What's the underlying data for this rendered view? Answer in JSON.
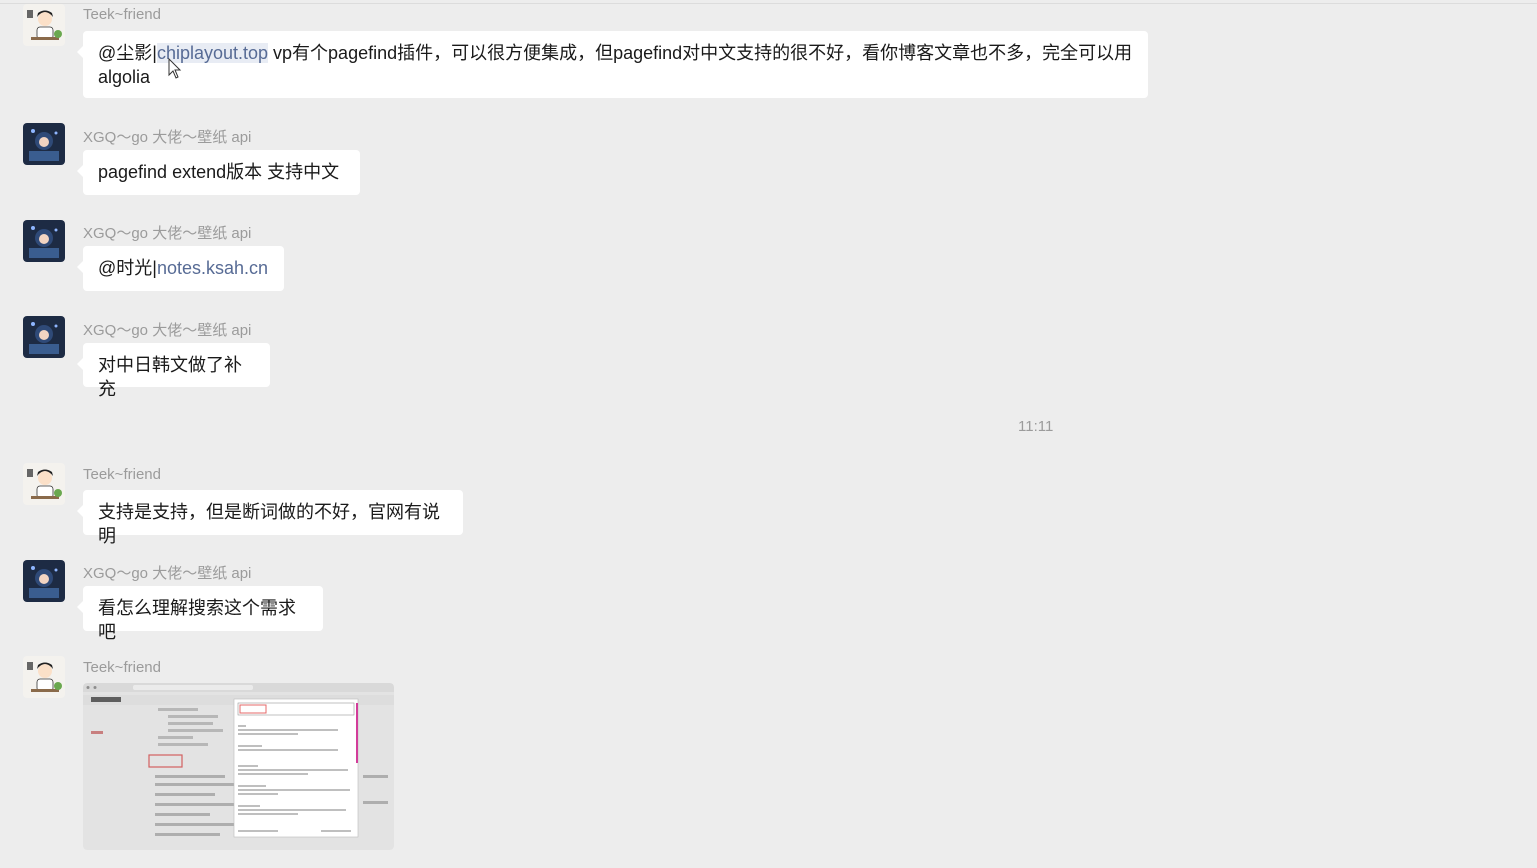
{
  "messages": [
    {
      "sender": "Teek~friend",
      "mention": "@尘影|",
      "link": "chiplayout.top",
      "text": " vp有个pagefind插件，可以很方便集成，但pagefind对中文支持的很不好，看你博客文章也不多，完全可以用",
      "text2": "algolia"
    },
    {
      "sender": "XGQ～go 大佬～壁纸 api",
      "text": "pagefind extend版本 支持中文"
    },
    {
      "sender": "XGQ～go 大佬～壁纸 api",
      "mention": "@时光|",
      "link": "notes.ksah.cn"
    },
    {
      "sender": "XGQ～go 大佬～壁纸 api",
      "text": "对中日韩文做了补充"
    },
    {
      "sender": "Teek~friend",
      "text": "支持是支持，但是断词做的不好，官网有说明"
    },
    {
      "sender": "XGQ～go 大佬～壁纸 api",
      "text": "看怎么理解搜索这个需求吧"
    },
    {
      "sender": "Teek~friend",
      "image": "screenshot-thumbnail"
    }
  ],
  "timestamp": "11:11",
  "colors": {
    "background": "#ededed",
    "bubble": "#ffffff",
    "link": "#576b95",
    "name": "#9b9b9b"
  }
}
